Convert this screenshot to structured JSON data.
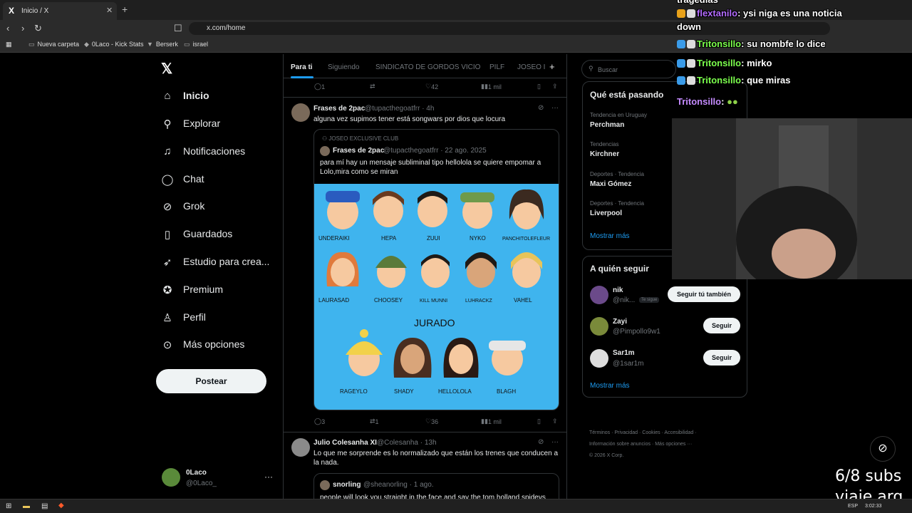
{
  "browser": {
    "tab_title": "Inicio / X",
    "url": "x.com/home",
    "bookmarks": [
      "Nueva carpeta",
      "0Laco - Kick Stats",
      "Berserk",
      "israel"
    ]
  },
  "nav": {
    "items": [
      {
        "label": "Inicio",
        "icon": "home-icon"
      },
      {
        "label": "Explorar",
        "icon": "search-icon"
      },
      {
        "label": "Notificaciones",
        "icon": "bell-icon"
      },
      {
        "label": "Chat",
        "icon": "chat-icon"
      },
      {
        "label": "Grok",
        "icon": "grok-icon"
      },
      {
        "label": "Guardados",
        "icon": "bookmark-icon"
      },
      {
        "label": "Estudio para crea...",
        "icon": "rocket-icon"
      },
      {
        "label": "Premium",
        "icon": "premium-icon"
      },
      {
        "label": "Perfil",
        "icon": "person-icon"
      },
      {
        "label": "Más opciones",
        "icon": "more-icon"
      }
    ],
    "post_label": "Postear",
    "account": {
      "name": "0Laco",
      "handle": "@0Laco_"
    }
  },
  "feed": {
    "tabs": [
      "Para ti",
      "Siguiendo",
      "SINDICATO DE GORDOS VICIO",
      "PILF",
      "JOSEO I"
    ],
    "top_actions": {
      "replies": "1",
      "reposts": "",
      "likes": "42",
      "views": "1 mil"
    },
    "post1": {
      "name": "Frases de 2pac",
      "handle": "@tupacthegoatfrr · 4h",
      "text": "alguna vez supimos tener está songwars por dios que locura",
      "quote": {
        "community": "JOSEO EXCLUSIVE CLUB",
        "name": "Frases de 2pac",
        "meta": "@tupacthegoatfrr · 22 ago. 2025",
        "text": "para mí hay un mensaje subliminal tipo hellolola se quiere empomar a Lolo,mira como se miran",
        "image": {
          "row1": [
            "UNDERAIKI",
            "HEPA",
            "ZUUI",
            "NYKO",
            "PANCHITOLEFLEUR"
          ],
          "row2": [
            "LAURASAD",
            "CHOOSEY",
            "KILL MUNNI",
            "LUHRACKZ",
            "VAHEL"
          ],
          "jurado_label": "JURADO",
          "row3": [
            "RAGEYLO",
            "SHADY",
            "HELLOLOLA",
            "BLAGH"
          ]
        }
      },
      "actions": {
        "replies": "3",
        "reposts": "1",
        "likes": "36",
        "views": "1 mil"
      }
    },
    "post2": {
      "name": "Julio Colesanha XI",
      "handle": "@Colesanha · 13h",
      "text": "Lo que me sorprende es lo normalizado que están los trenes que conducen a la nada.",
      "quote": {
        "name": "snorling",
        "meta": "@sheanorling · 1 ago.",
        "text": "people will look you straight in the face and say the tom holland spidevs"
      }
    }
  },
  "sidebar": {
    "search_placeholder": "Buscar",
    "trends_title": "Qué está pasando",
    "trends": [
      {
        "context": "Tendencia en Uruguay",
        "name": "Perchman"
      },
      {
        "context": "Tendencias",
        "name": "Kirchner"
      },
      {
        "context": "Deportes · Tendencia",
        "name": "Maxi Gómez"
      },
      {
        "context": "Deportes · Tendencia",
        "name": "Liverpool"
      }
    ],
    "show_more": "Mostrar más",
    "follow_title": "A quién seguir",
    "follow": [
      {
        "name": "nik",
        "handle": "@nik...",
        "badge": "Te sigue",
        "button": "Seguir tú también"
      },
      {
        "name": "Zayi",
        "handle": "@Pimpollo9w1",
        "button": "Seguir"
      },
      {
        "name": "Sar1m",
        "handle": "@1sar1m",
        "button": "Seguir"
      }
    ],
    "follow_show_more": "Mostrar más",
    "footer_line1": "Términos · Privacidad · Cookies · Accesibilidad ·",
    "footer_line2": "Información sobre anuncios · Más opciones ···",
    "footer_line3": "© 2026 X Corp."
  },
  "overlay_chat": {
    "lines": [
      {
        "user": "",
        "text": "tragedias",
        "color": "#ffffff"
      },
      {
        "user": "flextanilo",
        "text": ": ysi niga es una noticia",
        "color": "#b36cff"
      },
      {
        "user": "",
        "text": "down",
        "color": "#ffffff"
      },
      {
        "user": "Tritonsillo",
        "text": ": su nombfe lo dice",
        "color": "#7cff4d"
      },
      {
        "user": "Tritonsillo",
        "text": ": mirko",
        "color": "#7cff4d"
      },
      {
        "user": "Tritonsillo",
        "text": ": que miras",
        "color": "#7cff4d"
      },
      {
        "user": "Tritonsillo",
        "text": ":",
        "color": "#c58bff"
      }
    ]
  },
  "stream": {
    "subs_line1": "6/8 subs",
    "subs_line2": "viaje arg"
  },
  "taskbar": {
    "lang": "ESP",
    "time": "3:02:33"
  }
}
